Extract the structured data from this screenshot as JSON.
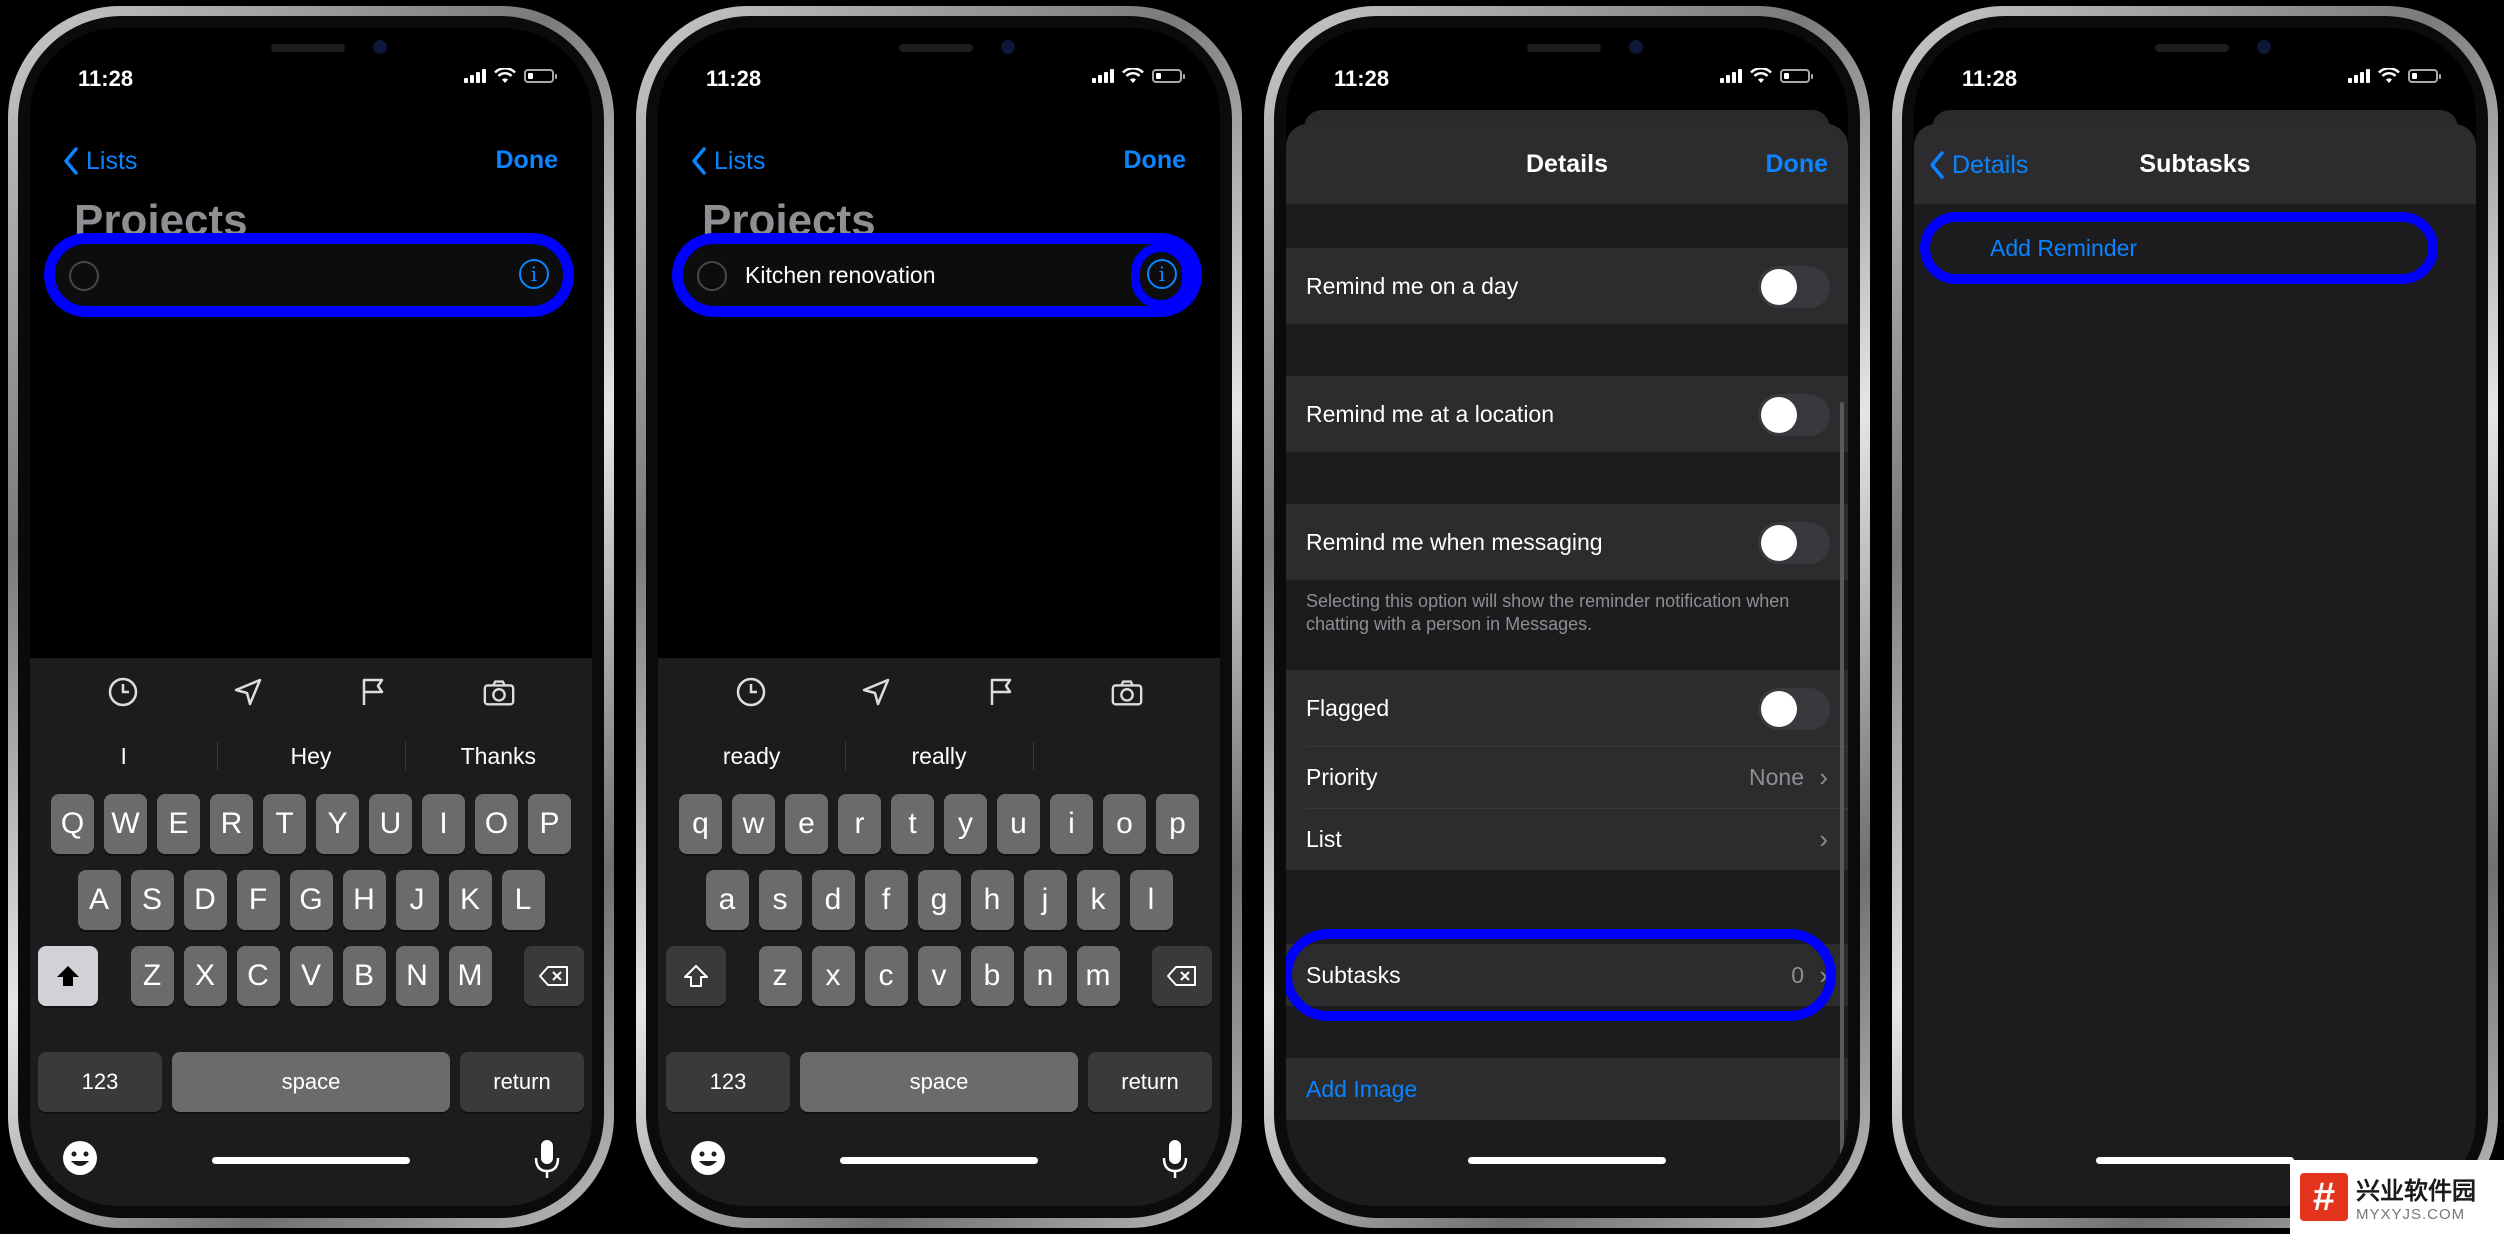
{
  "status": {
    "time": "11:28"
  },
  "phone1": {
    "back_label": "Lists",
    "done_label": "Done",
    "title": "Projects",
    "entry_text": "",
    "suggestions": [
      "I",
      "Hey",
      "Thanks"
    ],
    "rows": [
      [
        "Q",
        "W",
        "E",
        "R",
        "T",
        "Y",
        "U",
        "I",
        "O",
        "P"
      ],
      [
        "A",
        "S",
        "D",
        "F",
        "G",
        "H",
        "J",
        "K",
        "L"
      ],
      [
        "Z",
        "X",
        "C",
        "V",
        "B",
        "N",
        "M"
      ]
    ],
    "key_123": "123",
    "key_space": "space",
    "key_return": "return"
  },
  "phone2": {
    "back_label": "Lists",
    "done_label": "Done",
    "title": "Projects",
    "entry_text": "Kitchen renovation",
    "suggestions": [
      "ready",
      "really",
      ""
    ],
    "rows": [
      [
        "q",
        "w",
        "e",
        "r",
        "t",
        "y",
        "u",
        "i",
        "o",
        "p"
      ],
      [
        "a",
        "s",
        "d",
        "f",
        "g",
        "h",
        "j",
        "k",
        "l"
      ],
      [
        "z",
        "x",
        "c",
        "v",
        "b",
        "n",
        "m"
      ]
    ],
    "key_123": "123",
    "key_space": "space",
    "key_return": "return"
  },
  "phone3": {
    "title": "Details",
    "done_label": "Done",
    "remind_day": "Remind me on a day",
    "remind_location": "Remind me at a location",
    "remind_messaging": "Remind me when messaging",
    "messaging_footnote": "Selecting this option will show the reminder notification when chatting with a person in Messages.",
    "flagged": "Flagged",
    "priority": "Priority",
    "priority_value": "None",
    "list": "List",
    "subtasks": "Subtasks",
    "subtasks_count": "0",
    "add_image": "Add Image"
  },
  "phone4": {
    "back_label": "Details",
    "title": "Subtasks",
    "add_reminder": "Add Reminder"
  },
  "watermark": {
    "name": "兴业软件园",
    "url": "MYXYJS.COM"
  },
  "colors": {
    "accent": "#0a84ff",
    "highlight": "#0000ff",
    "background": "#000000",
    "cell": "#2c2c2e"
  },
  "icons": [
    "chevron-left-icon",
    "info-icon",
    "clock-icon",
    "location-arrow-icon",
    "flag-icon",
    "camera-icon",
    "shift-icon",
    "delete-icon",
    "emoji-icon",
    "microphone-icon",
    "chevron-right-icon"
  ]
}
